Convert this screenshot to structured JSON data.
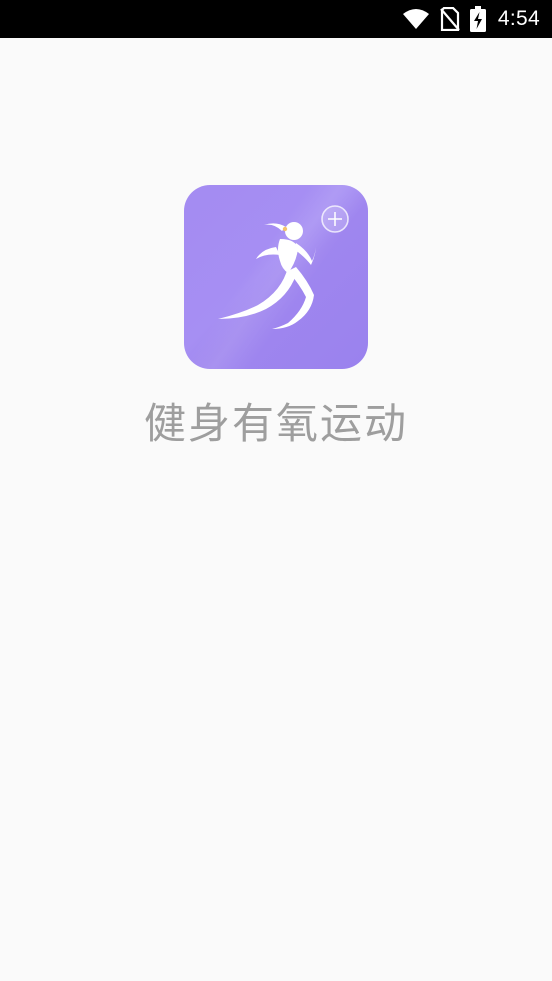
{
  "status_bar": {
    "time": "4:54",
    "icons": [
      "wifi-icon",
      "no-sim-icon",
      "battery-charging-icon"
    ],
    "background": "#000000"
  },
  "splash": {
    "app_name": "健身有氧运动",
    "app_icon": "running-woman-icon",
    "icon_color": "#a48bf2",
    "background": "#fafafa",
    "text_color": "#9e9e9e"
  }
}
